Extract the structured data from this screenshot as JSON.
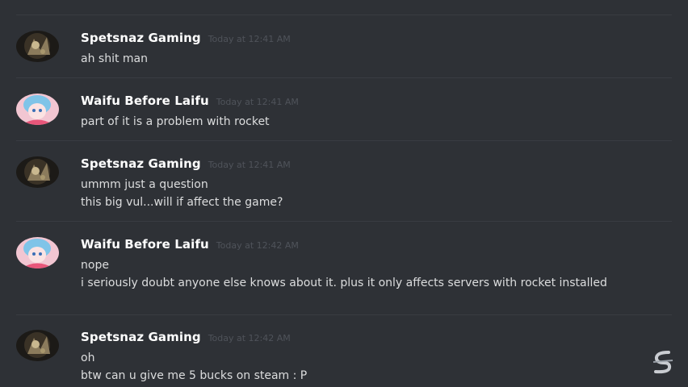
{
  "messages": [
    {
      "username": "Spetsnaz Gaming",
      "timestamp": "Today at 12:41 AM",
      "avatar": "spetsnaz-avatar",
      "lines": [
        "ah shit man"
      ]
    },
    {
      "username": "Waifu Before Laifu",
      "timestamp": "Today at 12:41 AM",
      "avatar": "waifu-avatar",
      "lines": [
        "part of it is a problem with rocket"
      ]
    },
    {
      "username": "Spetsnaz Gaming",
      "timestamp": "Today at 12:41 AM",
      "avatar": "spetsnaz-avatar",
      "lines": [
        "ummm just a question",
        "this big vul...will if affect the game?"
      ]
    },
    {
      "username": "Waifu Before Laifu",
      "timestamp": "Today at 12:42 AM",
      "avatar": "waifu-avatar",
      "lines": [
        "nope",
        "i seriously doubt anyone else knows about it. plus it only affects servers with rocket installed"
      ]
    },
    {
      "username": "Spetsnaz Gaming",
      "timestamp": "Today at 12:42 AM",
      "avatar": "spetsnaz-avatar",
      "lines": [
        "oh",
        "btw can u give me 5 bucks on steam : P"
      ]
    }
  ],
  "watermark": "channel-logo-watermark"
}
